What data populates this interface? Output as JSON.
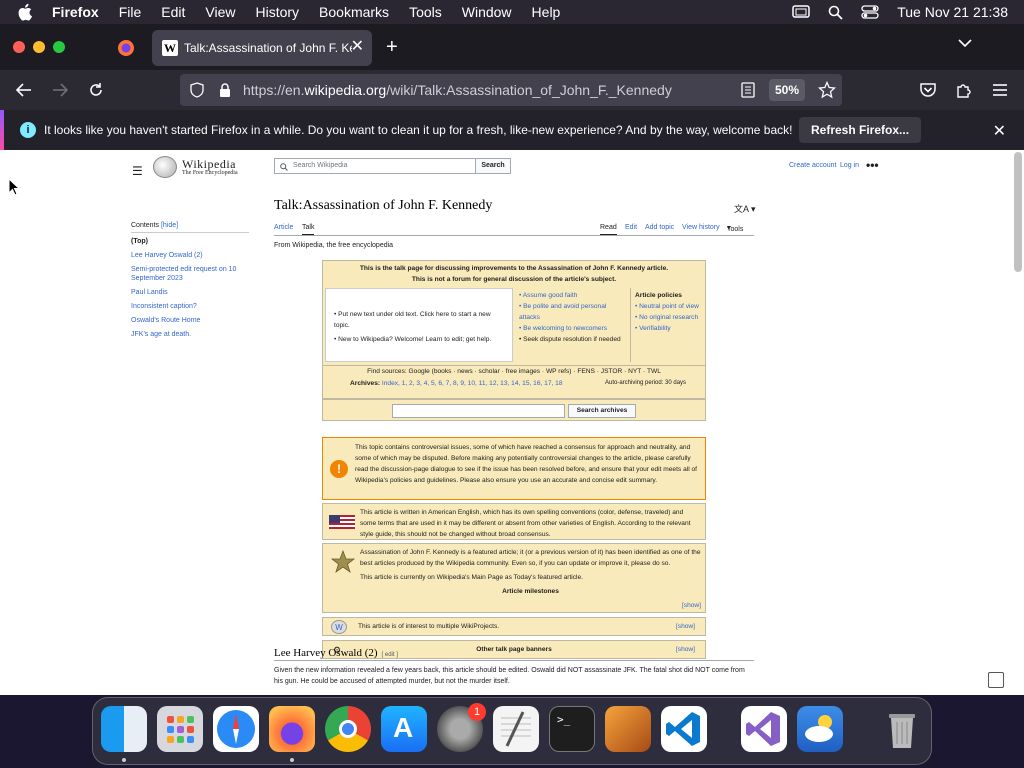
{
  "menubar": {
    "app": "Firefox",
    "items": [
      "File",
      "Edit",
      "View",
      "History",
      "Bookmarks",
      "Tools",
      "Window",
      "Help"
    ],
    "clock": "Tue Nov 21  21:38"
  },
  "tab": {
    "title": "Talk:Assassination of John F. Kennedy",
    "favicon": "W"
  },
  "urlbar": {
    "prefix": "https://en.",
    "domain": "wikipedia.org",
    "path": "/wiki/Talk:Assassination_of_John_F._Kennedy",
    "zoom": "50%"
  },
  "notification": {
    "message": "It looks like you haven't started Firefox in a while. Do you want to clean it up for a fresh, like-new experience? And by the way, welcome back!",
    "button": "Refresh Firefox..."
  },
  "wiki": {
    "name": "Wikipedia",
    "tagline": "The Free Encyclopedia",
    "search_placeholder": "Search Wikipedia",
    "search_button": "Search",
    "create_account": "Create account",
    "log_in": "Log in",
    "toc": {
      "title": "Contents",
      "hide": "[hide]",
      "items": [
        "(Top)",
        "Lee Harvey Oswald (2)",
        "Semi-protected edit request on 10 September 2023",
        "Paul Landis",
        "Inconsistent caption?",
        "Oswald's Route Home",
        "JFK's age at death."
      ]
    },
    "title": "Talk:Assassination of John F. Kennedy",
    "tabs": {
      "article": "Article",
      "talk": "Talk",
      "read": "Read",
      "edit": "Edit",
      "add_topic": "Add topic",
      "view_history": "View history",
      "tools": "Tools"
    },
    "from": "From Wikipedia, the free encyclopedia",
    "header1": "This is the talk page for discussing improvements to the Assassination of John F. Kennedy article.",
    "header2": "This is not a forum for general discussion of the article's subject.",
    "newtext": "Put new text under old text. Click here to start a new topic.",
    "newuser": "New to Wikipedia? Welcome! Learn to edit; get help.",
    "guidelines": [
      "Assume good faith",
      "Be polite and avoid personal attacks",
      "Be welcoming to newcomers",
      "Seek dispute resolution if needed"
    ],
    "policies_title": "Article policies",
    "policies": [
      "Neutral point of view",
      "No original research",
      "Verifiability"
    ],
    "find_sources": "Find sources: Google (books · news · scholar · free images · WP refs) · FENS · JSTOR · NYT · TWL",
    "archives_label": "Archives:",
    "archives": "Index, 1, 2, 3, 4, 5, 6, 7, 8, 9, 10, 11, 12, 13, 14, 15, 16, 17, 18",
    "auto_archive": "Auto-archiving period: 30 days",
    "search_archives": "Search archives",
    "controversial": "This topic contains controversial issues, some of which have reached a consensus for approach and neutrality, and some of which may be disputed. Before making any potentially controversial changes to the article, please carefully read the discussion-page dialogue to see if the issue has been resolved before, and ensure that your edit meets all of Wikipedia's policies and guidelines. Please also ensure you use an accurate and concise edit summary.",
    "american": "This article is written in American English, which has its own spelling conventions (color, defense, traveled) and some terms that are used in it may be different or absent from other varieties of English. According to the relevant style guide, this should not be changed without broad consensus.",
    "featured": "Assassination of John F. Kennedy is a featured article; it (or a previous version of it) has been identified as one of the best articles produced by the Wikipedia community. Even so, if you can update or improve it, please do so.",
    "mainpage": "This article is currently on Wikipedia's Main Page as Today's featured article.",
    "milestones": "Article milestones",
    "show": "[show]",
    "wikiprojects": "This article is of interest to multiple WikiProjects.",
    "other_banners": "Other talk page banners",
    "section": "Lee Harvey Oswald (2)",
    "section_edit": "[ edit ]",
    "para": "Given the new information revealed a few years back, this article should be edited. Oswald did NOT assassinate JFK. The fatal shot did NOT come from his gun. He could be accused of attempted murder, but not the murder itself."
  },
  "dock": {
    "badge": "1"
  }
}
